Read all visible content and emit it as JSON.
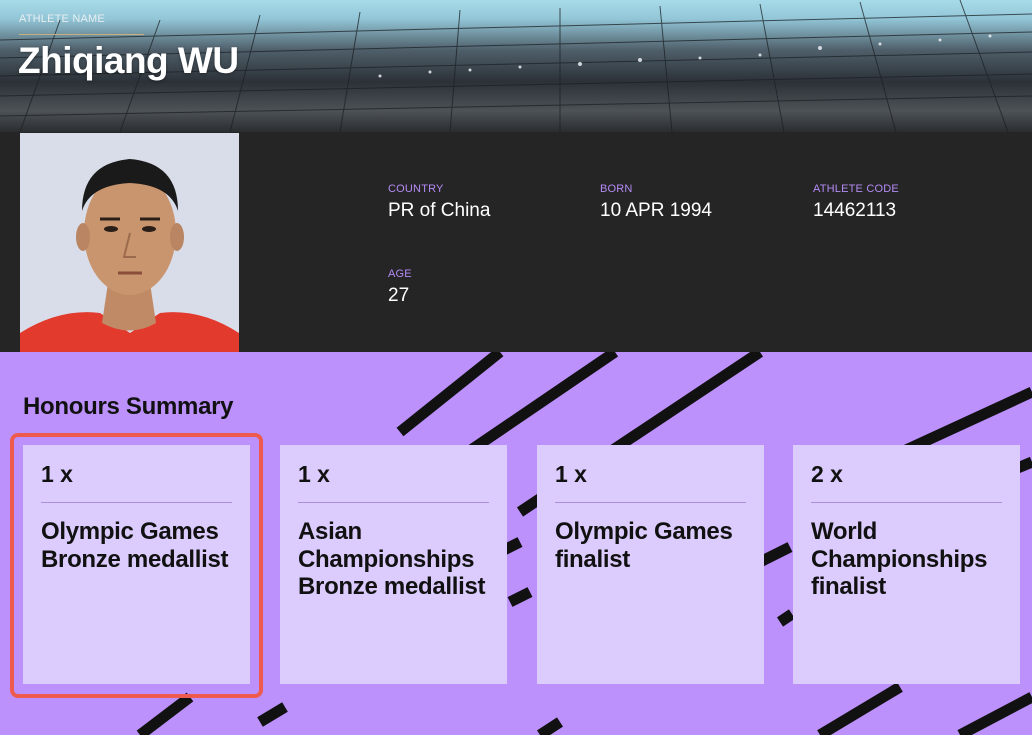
{
  "header": {
    "label": "ATHLETE NAME",
    "athlete_name": "Zhiqiang WU"
  },
  "profile": {
    "photo_alt": "Zhiqiang WU",
    "fields": [
      {
        "label": "COUNTRY",
        "value": "PR of China"
      },
      {
        "label": "BORN",
        "value": "10 APR 1994"
      },
      {
        "label": "ATHLETE CODE",
        "value": "14462113"
      },
      {
        "label": "AGE",
        "value": "27"
      }
    ]
  },
  "honours": {
    "title": "Honours Summary",
    "cards": [
      {
        "count": "1 x",
        "description": "Olympic Games Bronze medallist"
      },
      {
        "count": "1 x",
        "description": "Asian Championships Bronze medallist"
      },
      {
        "count": "1 x",
        "description": "Olympic Games finalist"
      },
      {
        "count": "2 x",
        "description": "World Championships finalist"
      }
    ]
  },
  "colors": {
    "accent_purple": "#bd91fc",
    "card_bg": "#dccbfd",
    "label_purple": "#b48bf5",
    "highlight_red": "#ef5a4e",
    "dark_bg": "#252525"
  }
}
